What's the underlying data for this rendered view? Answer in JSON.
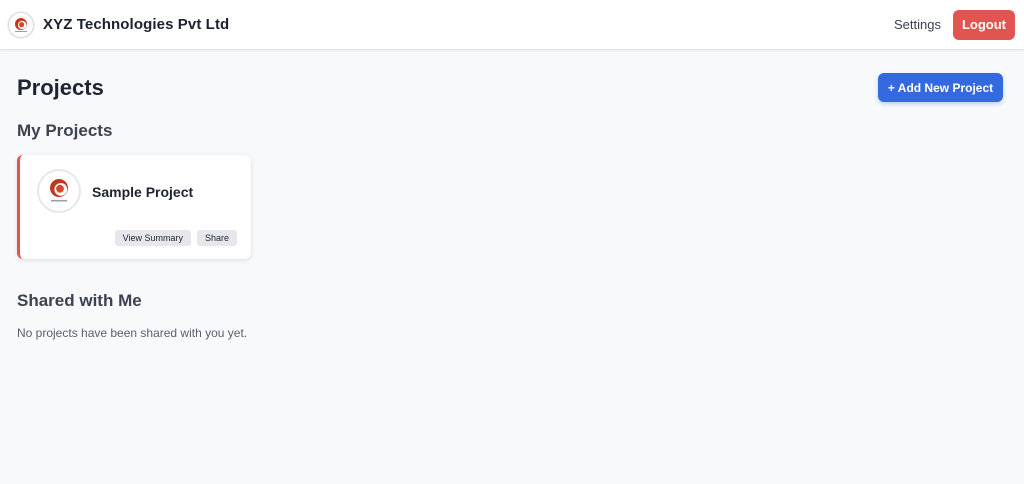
{
  "header": {
    "brand_name": "XYZ Technologies Pvt Ltd",
    "logo_icon": "company-logo-icon",
    "settings_label": "Settings",
    "logout_label": "Logout"
  },
  "page": {
    "title": "Projects",
    "add_button_label": "+ Add New Project"
  },
  "my_projects": {
    "title": "My Projects",
    "cards": [
      {
        "name": "Sample Project",
        "logo_icon": "project-logo-icon",
        "actions": [
          "View Summary",
          "Share"
        ]
      }
    ]
  },
  "shared": {
    "title": "Shared with Me",
    "empty_message": "No projects have been shared with you yet."
  },
  "colors": {
    "accent_blue": "#3569e0",
    "danger_red": "#e25450",
    "background": "#f8f9fb"
  }
}
